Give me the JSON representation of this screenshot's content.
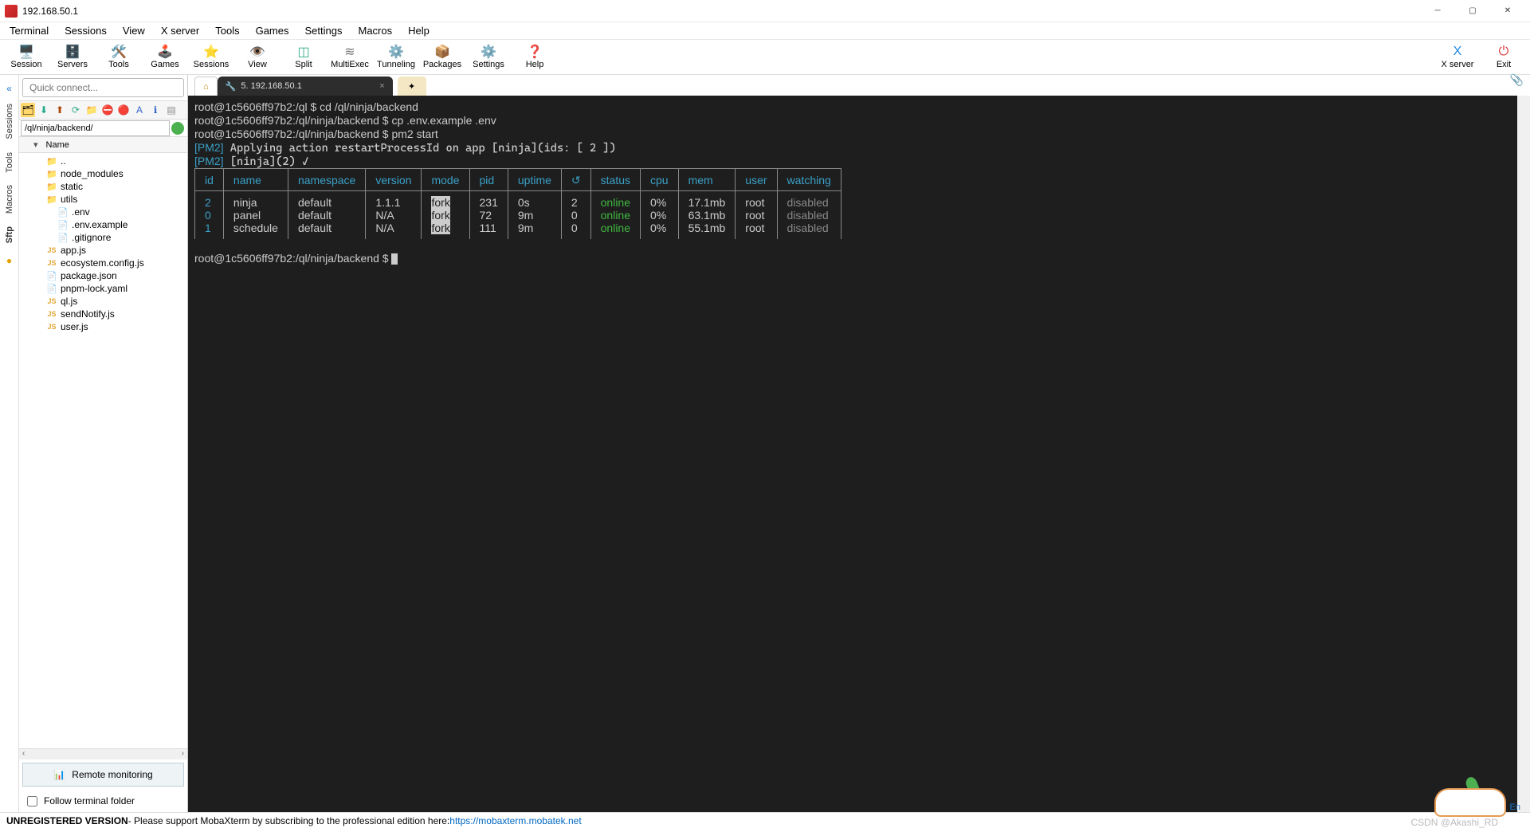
{
  "window": {
    "title": "192.168.50.1"
  },
  "menubar": [
    "Terminal",
    "Sessions",
    "View",
    "X server",
    "Tools",
    "Games",
    "Settings",
    "Macros",
    "Help"
  ],
  "toolbar": {
    "left": [
      {
        "name": "session-button",
        "icon": "🖥️",
        "label": "Session",
        "color": "#d33"
      },
      {
        "name": "servers-button",
        "icon": "🗄️",
        "label": "Servers",
        "color": "#3a8"
      },
      {
        "name": "tools-button",
        "icon": "🛠️",
        "label": "Tools",
        "color": "#d33"
      },
      {
        "name": "games-button",
        "icon": "🕹️",
        "label": "Games",
        "color": "#e2a838"
      },
      {
        "name": "sessions-button",
        "icon": "⭐",
        "label": "Sessions",
        "color": "#e2a838"
      },
      {
        "name": "view-button",
        "icon": "👁️",
        "label": "View",
        "color": "#888"
      },
      {
        "name": "split-button",
        "icon": "◫",
        "label": "Split",
        "color": "#3a8"
      },
      {
        "name": "multiexec-button",
        "icon": "≋",
        "label": "MultiExec",
        "color": "#777"
      },
      {
        "name": "tunneling-button",
        "icon": "⚙️",
        "label": "Tunneling",
        "color": "#777"
      },
      {
        "name": "packages-button",
        "icon": "📦",
        "label": "Packages",
        "color": "#c80"
      },
      {
        "name": "settings-button",
        "icon": "⚙️",
        "label": "Settings",
        "color": "#777"
      },
      {
        "name": "help-button",
        "icon": "❓",
        "label": "Help",
        "color": "#1e88e5"
      }
    ],
    "right": [
      {
        "name": "xserver-button",
        "icon": "X",
        "label": "X server",
        "color": "#1e88e5"
      },
      {
        "name": "exit-button",
        "icon": "⏻",
        "label": "Exit",
        "color": "#d33"
      }
    ]
  },
  "quick": {
    "placeholder": "Quick connect..."
  },
  "rail": [
    "Sessions",
    "Tools",
    "Macros",
    "Sftp"
  ],
  "sftp": {
    "path": "/ql/ninja/backend/",
    "head": "Name",
    "nodes": [
      {
        "t": "up",
        "label": ".."
      },
      {
        "t": "folder",
        "label": "node_modules"
      },
      {
        "t": "folder",
        "label": "static"
      },
      {
        "t": "folder",
        "label": "utils"
      },
      {
        "t": "file",
        "label": ".env",
        "indent": true
      },
      {
        "t": "file",
        "label": ".env.example",
        "indent": true
      },
      {
        "t": "file",
        "label": ".gitignore",
        "indent": true
      },
      {
        "t": "js",
        "label": "app.js"
      },
      {
        "t": "js",
        "label": "ecosystem.config.js"
      },
      {
        "t": "file",
        "label": "package.json"
      },
      {
        "t": "file",
        "label": "pnpm-lock.yaml"
      },
      {
        "t": "js",
        "label": "ql.js"
      },
      {
        "t": "js",
        "label": "sendNotify.js"
      },
      {
        "t": "js",
        "label": "user.js"
      }
    ],
    "remote": "Remote monitoring",
    "follow": "Follow terminal folder"
  },
  "tabs": {
    "home_icon": "⌂",
    "active": "5. 192.168.50.1",
    "active_icon": "🔧"
  },
  "terminal": {
    "lines": [
      {
        "prompt": "root@1c5606ff97b2:/ql $",
        "cmd": " cd /ql/ninja/backend"
      },
      {
        "prompt": "root@1c5606ff97b2:/ql/ninja/backend $",
        "cmd": " cp .env.example .env"
      },
      {
        "prompt": "root@1c5606ff97b2:/ql/ninja/backend $",
        "cmd": " pm2 start"
      }
    ],
    "pm2_msgs": [
      "Applying action restartProcessId on app [ninja](ids: [ 2 ])",
      "[ninja](2) ✓"
    ],
    "pm2_head": [
      "id",
      "name",
      "namespace",
      "version",
      "mode",
      "pid",
      "uptime",
      "↺",
      "status",
      "cpu",
      "mem",
      "user",
      "watching"
    ],
    "pm2_rows": [
      {
        "id": "2",
        "name": "ninja",
        "namespace": "default",
        "version": "1.1.1",
        "mode": "fork",
        "pid": "231",
        "uptime": "0s",
        "restarts": "2",
        "status": "online",
        "cpu": "0%",
        "mem": "17.1mb",
        "user": "root",
        "watching": "disabled"
      },
      {
        "id": "0",
        "name": "panel",
        "namespace": "default",
        "version": "N/A",
        "mode": "fork",
        "pid": "72",
        "uptime": "9m",
        "restarts": "0",
        "status": "online",
        "cpu": "0%",
        "mem": "63.1mb",
        "user": "root",
        "watching": "disabled"
      },
      {
        "id": "1",
        "name": "schedule",
        "namespace": "default",
        "version": "N/A",
        "mode": "fork",
        "pid": "111",
        "uptime": "9m",
        "restarts": "0",
        "status": "online",
        "cpu": "0%",
        "mem": "55.1mb",
        "user": "root",
        "watching": "disabled"
      }
    ],
    "last_prompt": "root@1c5606ff97b2:/ql/ninja/backend $ "
  },
  "status": {
    "unreg": "UNREGISTERED VERSION",
    "msg": "  -  Please support MobaXterm by subscribing to the professional edition here:  ",
    "url": "https://mobaxterm.mobatek.net"
  },
  "watermark": "CSDN @Akashi_RD",
  "lang": "En"
}
